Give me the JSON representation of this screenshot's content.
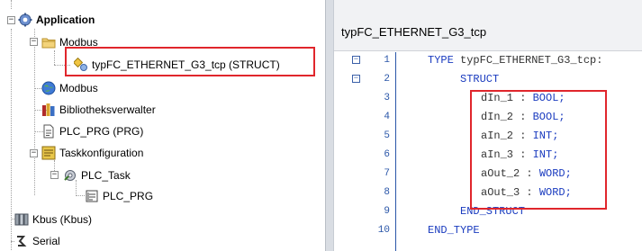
{
  "tree": {
    "items": [
      {
        "label": "Application",
        "icon": "application-gear-icon"
      },
      {
        "label": "Modbus",
        "icon": "folder-icon"
      },
      {
        "label": "typFC_ETHERNET_G3_tcp (STRUCT)",
        "icon": "struct-icon"
      },
      {
        "label": "Modbus",
        "icon": "globe-icon"
      },
      {
        "label": "Bibliotheksverwalter",
        "icon": "library-books-icon"
      },
      {
        "label": "PLC_PRG (PRG)",
        "icon": "document-icon"
      },
      {
        "label": "Taskkonfiguration",
        "icon": "task-config-icon"
      },
      {
        "label": "PLC_Task",
        "icon": "task-gear-icon"
      },
      {
        "label": "PLC_PRG",
        "icon": "program-call-icon"
      },
      {
        "label": "Kbus (Kbus)",
        "icon": "kbus-icon"
      },
      {
        "label": "Serial",
        "icon": "serial-icon"
      }
    ],
    "expanders": [
      "−",
      "−",
      "−",
      "−"
    ]
  },
  "editor": {
    "title": "typFC_ETHERNET_G3_tcp",
    "folds": [
      "−",
      "−"
    ],
    "lines": [
      {
        "num": "1",
        "kw": "TYPE ",
        "rest": "typFC_ETHERNET_G3_tcp:"
      },
      {
        "num": "2",
        "kw": "STRUCT",
        "rest": ""
      },
      {
        "num": "3",
        "id": "dIn_1 : ",
        "type": "BOOL;"
      },
      {
        "num": "4",
        "id": "dIn_2 : ",
        "type": "BOOL;"
      },
      {
        "num": "5",
        "id": "aIn_2 : ",
        "type": "INT;"
      },
      {
        "num": "6",
        "id": "aIn_3 : ",
        "type": "INT;"
      },
      {
        "num": "7",
        "id": "aOut_2 : ",
        "type": "WORD;"
      },
      {
        "num": "8",
        "id": "aOut_3 : ",
        "type": "WORD;"
      },
      {
        "num": "9",
        "kw": "END_STRUCT",
        "rest": ""
      },
      {
        "num": "10",
        "kw": "END_TYPE",
        "rest": ""
      }
    ]
  },
  "colors": {
    "highlight": "#e0262c",
    "keyword": "#1a3bbf",
    "line_numbers": "#2a56a8"
  }
}
